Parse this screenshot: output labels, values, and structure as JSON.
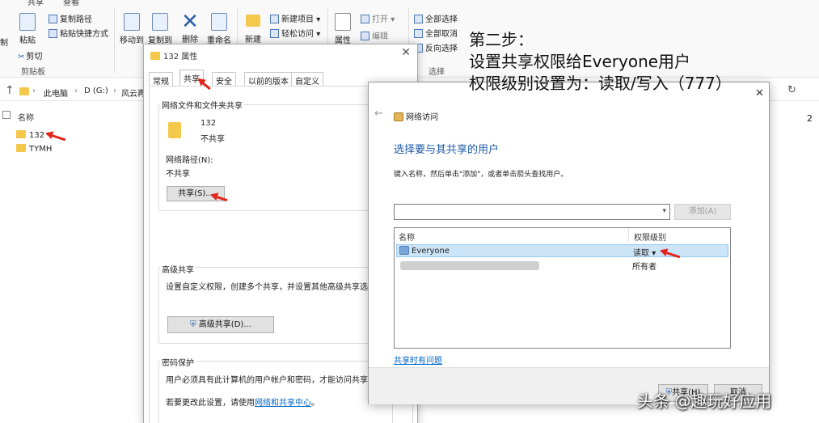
{
  "explorer": {
    "ribbon_top_tabs": [
      "共享",
      "查看"
    ],
    "ribbon": {
      "left_partial": [
        "制",
        "粘贴"
      ],
      "copy_path": "复制路径",
      "paste_shortcut": "粘贴快捷方式",
      "cut": "剪切",
      "clipboard_group": "剪贴板",
      "move_to": "移动到",
      "copy_to": "复制到",
      "delete": "删除",
      "rename": "重命名",
      "new_folder": "新建",
      "new_item": "新建项目",
      "easy_access": "轻松访问",
      "properties": "属性",
      "open": "打开",
      "edit": "编辑",
      "select_all": "全部选择",
      "select_none": "全部取消",
      "invert_selection": "反向选择",
      "select_group": "选择"
    },
    "breadcrumb": [
      "此电脑",
      "D (G:)",
      "风云再"
    ],
    "right_edge": "2",
    "column_name": "名称",
    "files": [
      "132",
      "TYMH"
    ]
  },
  "properties": {
    "title": "132 属性",
    "tabs": [
      "常规",
      "共享",
      "安全",
      "以前的版本",
      "自定义"
    ],
    "active_tab": "共享",
    "network_section_title": "网络文件和文件夹共享",
    "folder_name": "132",
    "share_state": "不共享",
    "network_path_label": "网络路径(N):",
    "network_path_value": "不共享",
    "share_button": "共享(S)...",
    "advanced_section_title": "高级共享",
    "advanced_desc": "设置自定义权限，创建多个共享，并设置其他高级共享选",
    "advanced_button": "高级共享(D)...",
    "password_section_title": "密码保护",
    "password_desc": "用户必须具有此计算机的用户帐户和密码，才能访问共享文",
    "password_change_prefix": "若要更改此设置，请使用",
    "password_change_link": "网络和共享中心",
    "password_change_suffix": "。"
  },
  "network_dialog": {
    "title": "网络访问",
    "heading": "选择要与其共享的用户",
    "instruction": "键入名称，然后单击\"添加\"，或者单击箭头查找用户。",
    "add_button": "添加(A)",
    "columns": [
      "名称",
      "权限级别"
    ],
    "rows": [
      {
        "name": "Everyone",
        "permission": "读取"
      },
      {
        "name": "",
        "permission": "所有者"
      }
    ],
    "help_link": "共享时有问题",
    "footer_buttons": [
      "共享(H)",
      "取消"
    ]
  },
  "annotation": {
    "lines": [
      "第二步：",
      "设置共享权限给Everyone用户",
      "权限级别设置为：读取/写入（777）"
    ]
  },
  "watermark": "头条 @趣玩好应用",
  "colors": {
    "heading_blue": "#1e5aa8",
    "link_blue": "#0066cc",
    "selection": "#cce4f7",
    "arrow_red": "#e2261d",
    "folder_yellow": "#f3c84b"
  }
}
